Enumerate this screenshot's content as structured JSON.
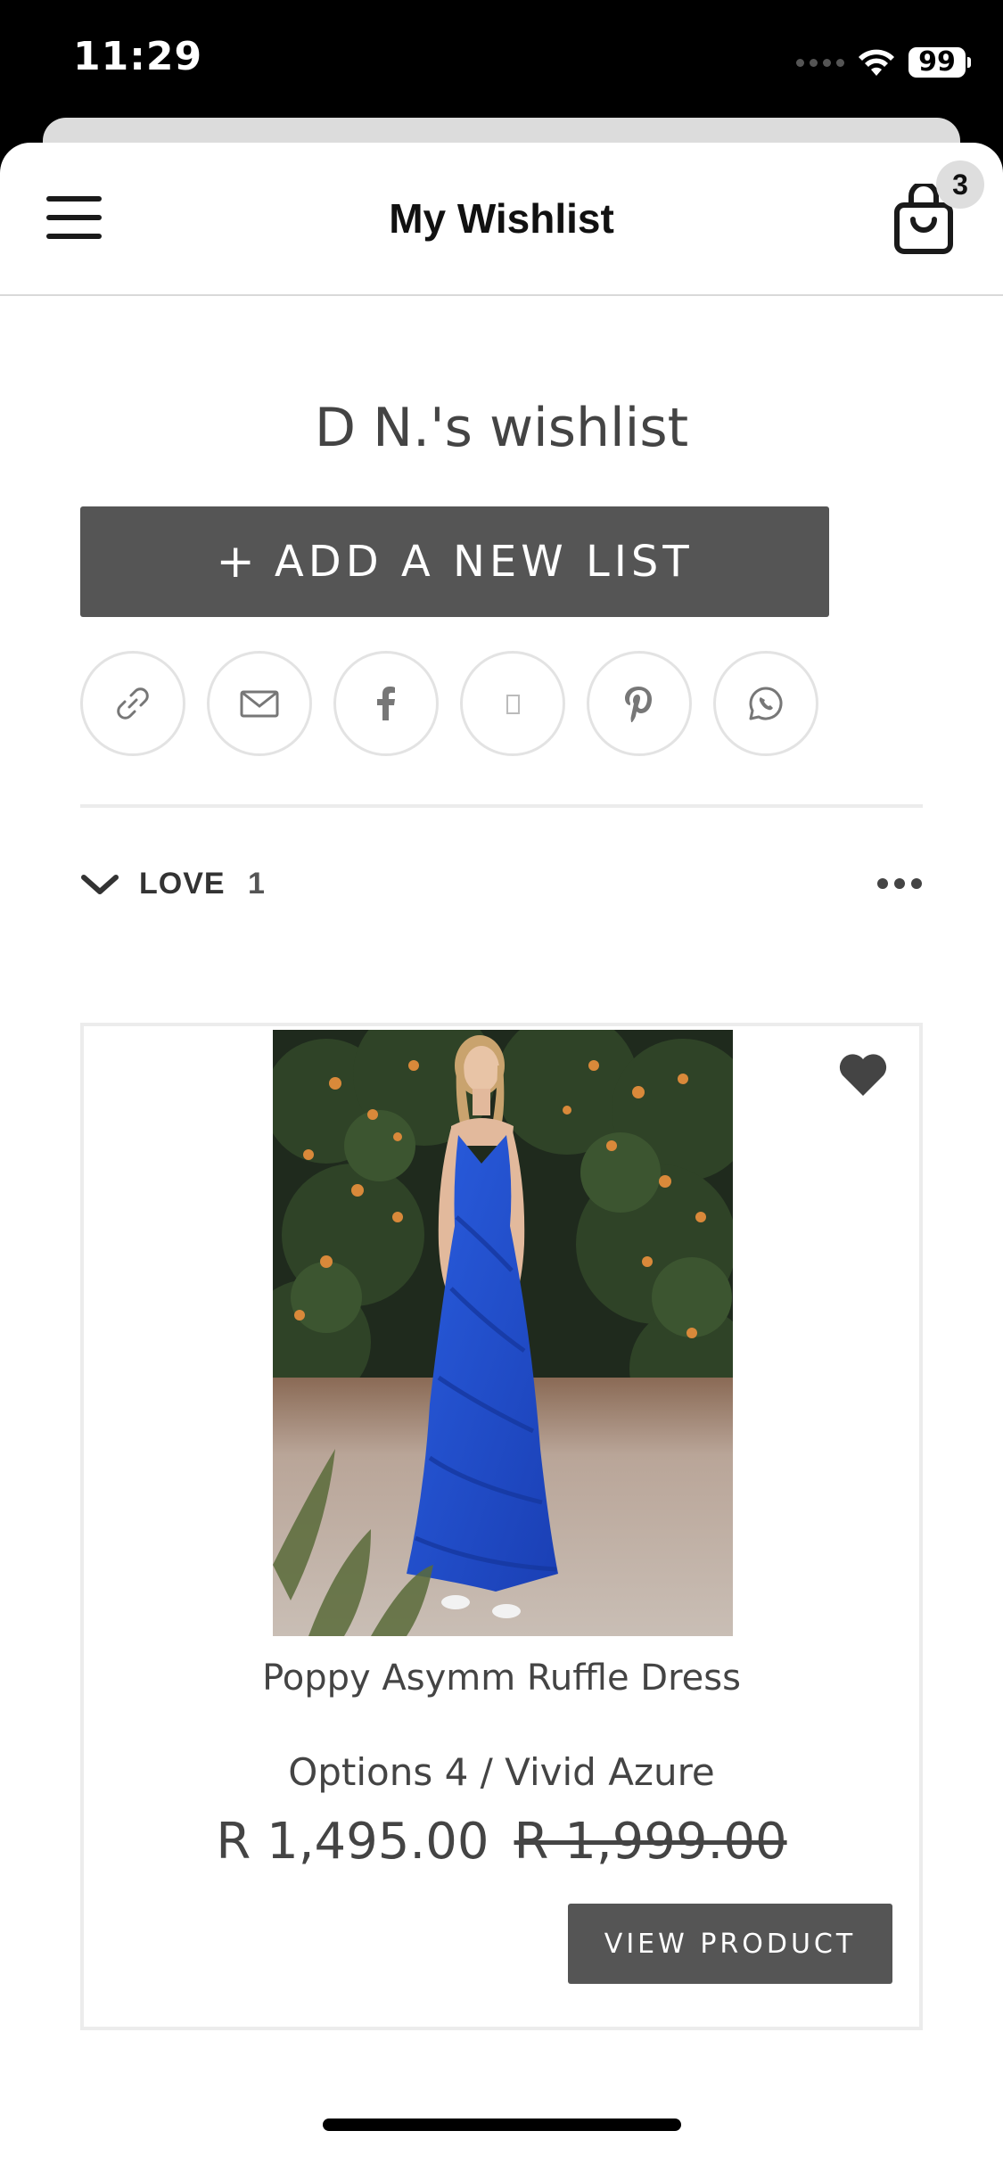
{
  "status_bar": {
    "time": "11:29",
    "battery": "99"
  },
  "header": {
    "title": "My Wishlist",
    "cart_count": "3"
  },
  "wishlist": {
    "title": "D N.'s wishlist",
    "add_list_plus": "+",
    "add_list_label": "ADD A NEW LIST"
  },
  "share_buttons": [
    {
      "icon": "link-icon"
    },
    {
      "icon": "email-icon"
    },
    {
      "icon": "facebook-icon"
    },
    {
      "icon": "blank-icon"
    },
    {
      "icon": "pinterest-icon"
    },
    {
      "icon": "whatsapp-icon"
    }
  ],
  "list": {
    "name": "LOVE",
    "count": "1"
  },
  "product": {
    "name": "Poppy Asymm Ruffle Dress",
    "options": "Options 4 / Vivid Azure",
    "price": "R 1,495.00",
    "compare_price": "R 1,999.00",
    "view_label": "VIEW PRODUCT"
  },
  "colors": {
    "button_bg": "#555555",
    "dress_blue": "#1f4fc9",
    "border": "#ececec"
  }
}
